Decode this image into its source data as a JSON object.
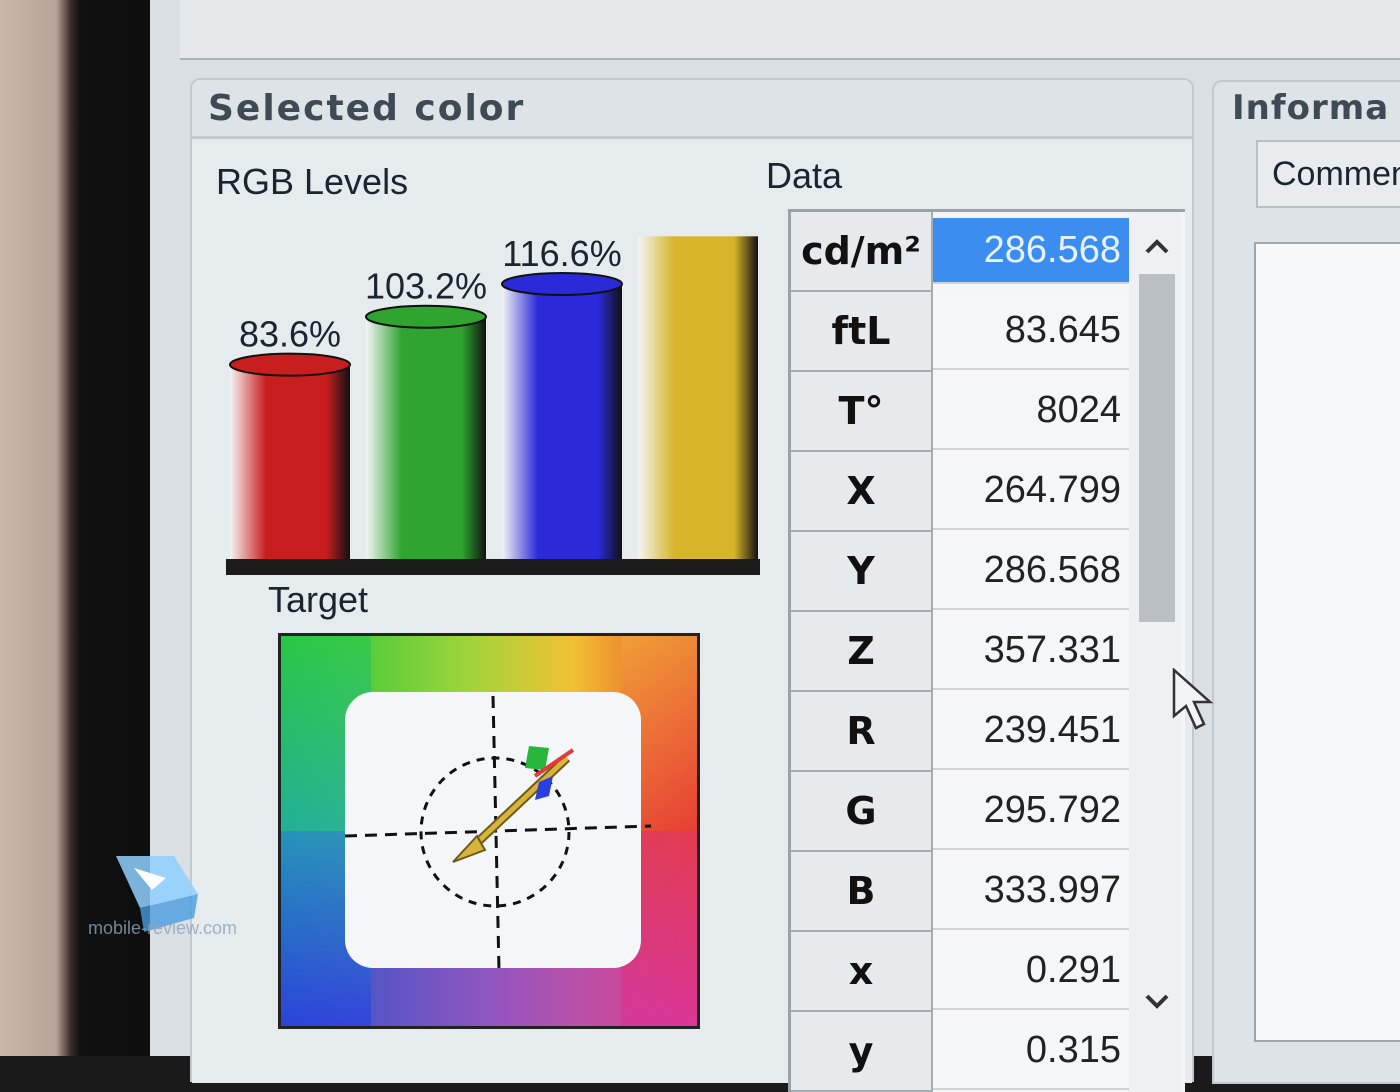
{
  "panel": {
    "title": "Selected color",
    "rgb_label": "RGB Levels",
    "data_label": "Data",
    "target_label": "Target"
  },
  "chart_data": {
    "type": "bar",
    "categories": [
      "R",
      "G",
      "B",
      "Y"
    ],
    "values": [
      83.6,
      103.2,
      116.6,
      132.0
    ],
    "data_labels": [
      "83.6%",
      "103.2%",
      "116.6%",
      ""
    ],
    "colors": [
      "#c81e1e",
      "#2fa52f",
      "#2a2ad8",
      "#d7b52a"
    ],
    "title": "",
    "xlabel": "",
    "ylabel": "",
    "ylim": [
      0,
      135
    ]
  },
  "table": {
    "rows": [
      {
        "label": "cd/m²",
        "value": "286.568",
        "selected": true
      },
      {
        "label": "ftL",
        "value": "83.645"
      },
      {
        "label": "T°",
        "value": "8024"
      },
      {
        "label": "X",
        "value": "264.799"
      },
      {
        "label": "Y",
        "value": "286.568"
      },
      {
        "label": "Z",
        "value": "357.331"
      },
      {
        "label": "R",
        "value": "239.451"
      },
      {
        "label": "G",
        "value": "295.792"
      },
      {
        "label": "B",
        "value": "333.997"
      },
      {
        "label": "x",
        "value": "0.291"
      },
      {
        "label": "y",
        "value": "0.315"
      }
    ],
    "scroll_up_icon": "chevron-up-icon",
    "scroll_down_icon": "chevron-down-icon"
  },
  "info": {
    "title": "Informa",
    "comment_tab": "Commen"
  },
  "watermark": {
    "text": "mobile-review.com"
  },
  "colors": {
    "selection": "#3c8df0",
    "panel_bg": "#e6ebee"
  }
}
